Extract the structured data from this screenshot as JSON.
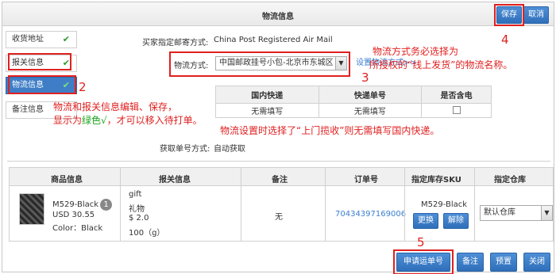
{
  "header": {
    "title": "物流信息",
    "save_label": "保存",
    "cancel_label": "取消"
  },
  "sidebar": {
    "items": [
      {
        "label": "收货地址",
        "check": "✔"
      },
      {
        "label": "报关信息",
        "check": "✔"
      },
      {
        "label": "物流信息",
        "check": "✔"
      },
      {
        "label": "备注信息",
        "check": ""
      }
    ]
  },
  "form": {
    "buyer_method_label": "买家指定邮寄方式:",
    "buyer_method_value": "China Post Registered Air Mail",
    "shipping_method_label": "物流方式:",
    "shipping_method_value": "中国邮政挂号小包-北京市东城区",
    "settings_link": "设置物流方式>>",
    "tracking_label": "获取单号方式:",
    "tracking_value": "自动获取"
  },
  "sub_table": {
    "headers": [
      "国内快递",
      "快递单号",
      "是否含电"
    ],
    "row": [
      "无需填写",
      "无需填写",
      ""
    ]
  },
  "annotations": {
    "note1_line1": "物流和报关信息编辑、保存，",
    "note1_line2_a": "显示为",
    "note1_line2_green": "绿色√",
    "note1_line2_b": "，才可以移入待打单。",
    "note2_line1": "物流方式务必选择为",
    "note2_line2": "所授权的“线上发货”的物流名称。",
    "note3": "物流设置时选择了“上门揽收”则无需填写国内快递。",
    "num2": "2",
    "num3": "3",
    "num4": "4",
    "num5": "5"
  },
  "order_table": {
    "headers": [
      "商品信息",
      "报关信息",
      "备注",
      "订单号",
      "指定库存SKU",
      "指定仓库"
    ],
    "product": {
      "name": "M529-Black x",
      "qty": "1",
      "price": "USD 30.55",
      "color": "Color：Black"
    },
    "customs": {
      "en_name": "gift",
      "cn_name": "礼物",
      "value": "$ 2.0",
      "weight": "100（g）"
    },
    "remark": "无",
    "order_no": "70434397169006",
    "sku": "M529-Black",
    "sku_change": "更换",
    "sku_remove": "解除",
    "warehouse": "默认仓库"
  },
  "footer": {
    "apply_label": "申请运单号",
    "remark_label": "备注",
    "print_label": "预置",
    "close_label": "关闭"
  }
}
